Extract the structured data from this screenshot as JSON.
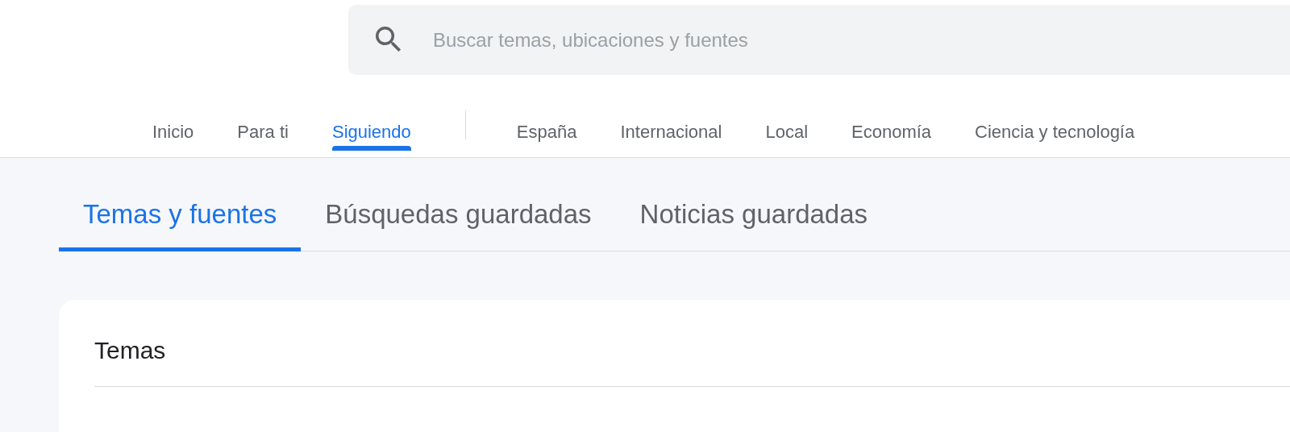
{
  "search": {
    "placeholder": "Buscar temas, ubicaciones y fuentes"
  },
  "nav": {
    "main": [
      {
        "label": "Inicio",
        "selected": false
      },
      {
        "label": "Para ti",
        "selected": false
      },
      {
        "label": "Siguiendo",
        "selected": true
      }
    ],
    "sections": [
      {
        "label": "España",
        "selected": false
      },
      {
        "label": "Internacional",
        "selected": false
      },
      {
        "label": "Local",
        "selected": false
      },
      {
        "label": "Economía",
        "selected": false
      },
      {
        "label": "Ciencia y tecnología",
        "selected": false
      }
    ]
  },
  "tabs": [
    {
      "label": "Temas y fuentes",
      "selected": true
    },
    {
      "label": "Búsquedas guardadas",
      "selected": false
    },
    {
      "label": "Noticias guardadas",
      "selected": false
    }
  ],
  "card": {
    "title": "Temas"
  }
}
